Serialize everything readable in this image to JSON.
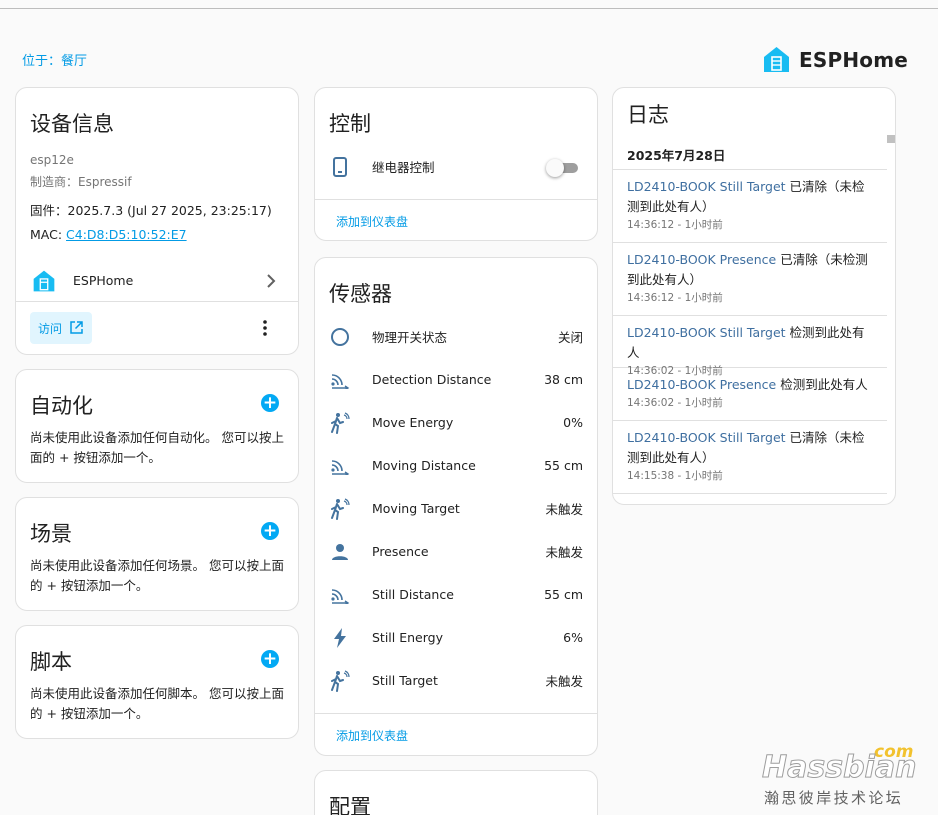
{
  "location": "位于：餐厅",
  "brand": {
    "name": "ESPHome",
    "color": "#18bcf2"
  },
  "device_info": {
    "title": "设备信息",
    "model": "esp12e",
    "manufacturer": "制造商：Espressif",
    "firmware": "固件：2025.7.3 (Jul 27 2025, 23:25:17)",
    "mac_label": "MAC: ",
    "mac": "C4:D8:D5:10:52:E7",
    "integration": "ESPHome",
    "visit_label": "访问"
  },
  "automation": {
    "title": "自动化",
    "text": "尚未使用此设备添加任何自动化。 您可以按上面的 + 按钮添加一个。"
  },
  "scene": {
    "title": "场景",
    "text": "尚未使用此设备添加任何场景。 您可以按上面的 + 按钮添加一个。"
  },
  "script": {
    "title": "脚本",
    "text": "尚未使用此设备添加任何脚本。 您可以按上面的 + 按钮添加一个。"
  },
  "controls": {
    "title": "控制",
    "relay_label": "继电器控制",
    "relay_on": false,
    "add_to_dashboard": "添加到仪表盘"
  },
  "sensors": {
    "title": "传感器",
    "add_to_dashboard": "添加到仪表盘",
    "items": [
      {
        "icon": "circle-outline-icon",
        "name": "物理开关状态",
        "value": "关闭"
      },
      {
        "icon": "signal-distance-icon",
        "name": "Detection Distance",
        "value": "38 cm"
      },
      {
        "icon": "motion-sensor-icon",
        "name": "Move Energy",
        "value": "0%"
      },
      {
        "icon": "signal-distance-icon",
        "name": "Moving Distance",
        "value": "55 cm"
      },
      {
        "icon": "motion-sensor-icon",
        "name": "Moving Target",
        "value": "未触发"
      },
      {
        "icon": "account-icon",
        "name": "Presence",
        "value": "未触发"
      },
      {
        "icon": "signal-distance-icon",
        "name": "Still Distance",
        "value": "55 cm"
      },
      {
        "icon": "flash-icon",
        "name": "Still Energy",
        "value": "6%"
      },
      {
        "icon": "motion-sensor-icon",
        "name": "Still Target",
        "value": "未触发"
      }
    ]
  },
  "config": {
    "title": "配置"
  },
  "logbook": {
    "title": "日志",
    "date": "2025年7月28日",
    "entries": [
      {
        "entity": "LD2410-BOOK Still Target",
        "message": " 已清除（未检测到此处有人）",
        "time": "14:36:12 - 1小时前"
      },
      {
        "entity": "LD2410-BOOK Presence",
        "message": " 已清除（未检测到此处有人）",
        "time": "14:36:12 - 1小时前"
      },
      {
        "entity": "LD2410-BOOK Still Target",
        "message": " 检测到此处有人",
        "time": "14:36:02 - 1小时前"
      },
      {
        "entity": "LD2410-BOOK Presence",
        "message": " 检测到此处有人",
        "time": "14:36:02 - 1小时前"
      },
      {
        "entity": "LD2410-BOOK Still Target",
        "message": " 已清除（未检测到此处有人）",
        "time": "14:15:38 - 1小时前"
      }
    ]
  },
  "watermark": {
    "site": "Hassbian",
    "tld": "com",
    "slogan": "瀚思彼岸技术论坛"
  }
}
